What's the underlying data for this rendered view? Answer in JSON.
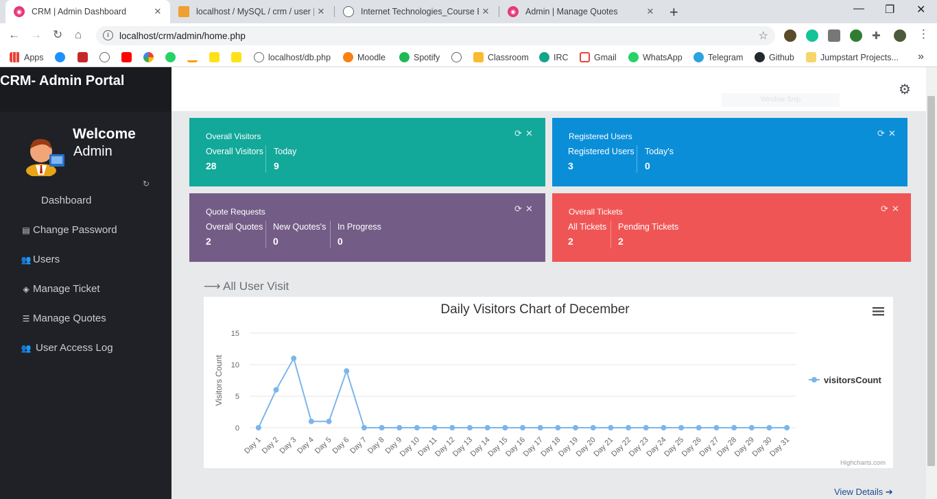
{
  "browser": {
    "tabs": [
      {
        "title": "CRM | Admin Dashboard",
        "active": true
      },
      {
        "title": "localhost / MySQL / crm / user | p",
        "active": false
      },
      {
        "title": "Internet Technologies_Course Eva",
        "active": false
      },
      {
        "title": "Admin | Manage Quotes",
        "active": false
      }
    ],
    "url": "localhost/crm/admin/home.php",
    "bookmarks": [
      "Apps",
      "localhost/db.php",
      "Moodle",
      "Spotify",
      "Classroom",
      "IRC",
      "Gmail",
      "WhatsApp",
      "Telegram",
      "Github",
      "Jumpstart Projects..."
    ],
    "overflow": "»"
  },
  "sidebar": {
    "brand": "CRM- Admin Portal",
    "welcome": "Welcome",
    "username": "Admin",
    "items": [
      {
        "label": "Dashboard",
        "icon": "dashboard-icon"
      },
      {
        "label": "Change Password",
        "icon": "document-icon"
      },
      {
        "label": "Users",
        "icon": "users-icon"
      },
      {
        "label": "Manage Ticket",
        "icon": "tag-icon"
      },
      {
        "label": "Manage Quotes",
        "icon": "list-icon"
      },
      {
        "label": "User Access Log",
        "icon": "users-icon"
      }
    ]
  },
  "topbar": {
    "faint_text": "Window Snip"
  },
  "cards": [
    {
      "title": "Overall Visitors",
      "color": "#12a89a",
      "stats": [
        {
          "label": "Overall Visitors",
          "value": "28"
        },
        {
          "label": "Today",
          "value": "9"
        }
      ]
    },
    {
      "title": "Registered Users",
      "color": "#0b8ed8",
      "stats": [
        {
          "label": "Registered Users",
          "value": "3"
        },
        {
          "label": "Today's",
          "value": "0"
        }
      ]
    },
    {
      "title": "Quote Requests",
      "color": "#735d87",
      "stats": [
        {
          "label": "Overall Quotes",
          "value": "2"
        },
        {
          "label": "New Quotes's",
          "value": "0"
        },
        {
          "label": "In Progress",
          "value": "0"
        }
      ]
    },
    {
      "title": "Overall Tickets",
      "color": "#f05555",
      "stats": [
        {
          "label": "All Tickets",
          "value": "2"
        },
        {
          "label": "Pending Tickets",
          "value": "2"
        }
      ]
    }
  ],
  "section_title": "All User Visit",
  "view_details": "View Details",
  "chart_data": {
    "type": "line",
    "title": "Daily Visitors Chart of December",
    "ylabel": "Visitors Count",
    "xlabel": "",
    "ylim": [
      0,
      15
    ],
    "yticks": [
      0,
      5,
      10,
      15
    ],
    "grid": true,
    "legend": "right",
    "credits": "Highcharts.com",
    "categories": [
      "Day 1",
      "Day 2",
      "Day 3",
      "Day 4",
      "Day 5",
      "Day 6",
      "Day 7",
      "Day 8",
      "Day 9",
      "Day 10",
      "Day 11",
      "Day 12",
      "Day 13",
      "Day 14",
      "Day 15",
      "Day 16",
      "Day 17",
      "Day 18",
      "Day 19",
      "Day 20",
      "Day 21",
      "Day 22",
      "Day 23",
      "Day 24",
      "Day 25",
      "Day 26",
      "Day 27",
      "Day 28",
      "Day 29",
      "Day 30",
      "Day 31"
    ],
    "series": [
      {
        "name": "visitorsCount",
        "color": "#7cb5ec",
        "values": [
          0,
          6,
          11,
          1,
          1,
          9,
          0,
          0,
          0,
          0,
          0,
          0,
          0,
          0,
          0,
          0,
          0,
          0,
          0,
          0,
          0,
          0,
          0,
          0,
          0,
          0,
          0,
          0,
          0,
          0,
          0
        ]
      }
    ]
  }
}
